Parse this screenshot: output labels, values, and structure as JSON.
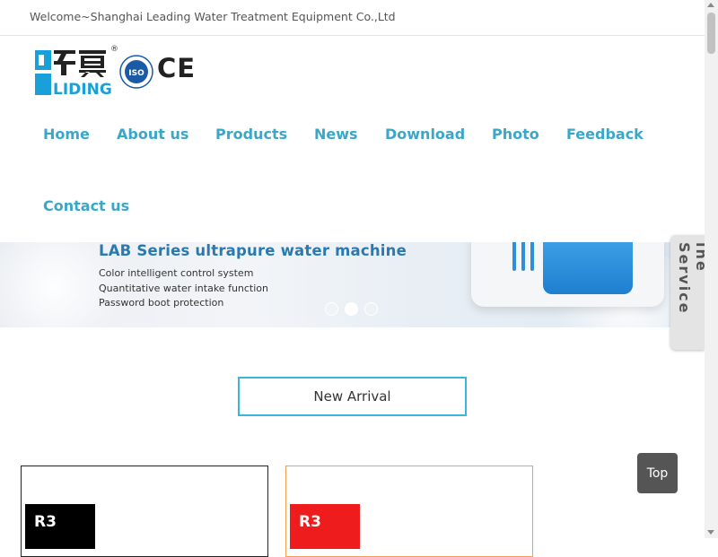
{
  "topbar": {
    "welcome_text": "Welcome~Shanghai Leading Water Treatment Equipment Co.,Ltd"
  },
  "logo": {
    "icon": "liding-logo-icon",
    "registered_mark": "®",
    "wordmark": "LIDING",
    "iso_text": "ISO",
    "ce_text": "CE",
    "brand_color": "#1aa0d8"
  },
  "nav": {
    "items": [
      {
        "label": "Home"
      },
      {
        "label": "About us"
      },
      {
        "label": "Products"
      },
      {
        "label": "News"
      },
      {
        "label": "Download"
      },
      {
        "label": "Photo"
      },
      {
        "label": "Feedback"
      },
      {
        "label": "Contact us"
      }
    ],
    "color": "#3aa7c9"
  },
  "banner": {
    "title": "LAB Series ultrapure water machine",
    "features": [
      "Color intelligent control system",
      "Quantitative water intake function",
      "Password boot protection"
    ],
    "slide_count": 3,
    "active_slide": 2
  },
  "side_tab": {
    "label": "ine Service"
  },
  "section": {
    "title": "New Arrival",
    "border_color": "#39b5de"
  },
  "products": [
    {
      "label": "R3",
      "border_color": "#222222",
      "label_bg": "#000000"
    },
    {
      "label": "R3",
      "border_color": "#f0a050",
      "label_bg": "#ee1c1c"
    }
  ],
  "back_to_top": {
    "label": "Top"
  }
}
